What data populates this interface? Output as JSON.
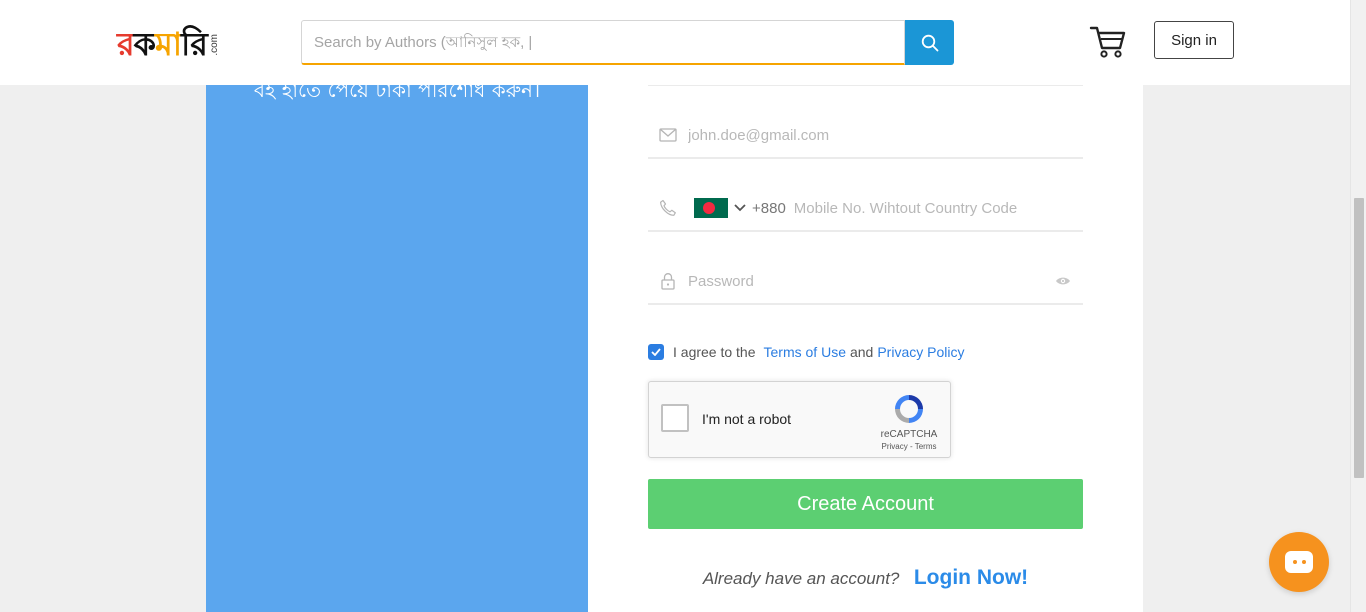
{
  "header": {
    "logo": {
      "main": "রকমারি",
      "suffix": ".com"
    },
    "search": {
      "placeholder": "Search by Authors (আনিসুল হক, |"
    },
    "cart_icon": "cart-icon",
    "signin_label": "Sign in"
  },
  "promo": {
    "text": "বই হাতে পেয়ে টাকা পরিশোধ করুন।"
  },
  "form": {
    "email": {
      "placeholder": "john.doe@gmail.com",
      "icon": "envelope-icon"
    },
    "phone": {
      "country_code": "+880",
      "placeholder": "Mobile No. Wihtout Country Code",
      "icon": "phone-icon",
      "flag": "bangladesh-flag"
    },
    "password": {
      "placeholder": "Password",
      "icon": "lock-icon"
    },
    "agree": {
      "prefix": "I agree to the",
      "terms": "Terms of Use",
      "and": "and",
      "privacy": "Privacy Policy",
      "checked": true
    },
    "recaptcha": {
      "label": "I'm not a robot",
      "brand": "reCAPTCHA",
      "links": "Privacy - Terms"
    },
    "create_button": "Create Account",
    "login": {
      "question": "Already have an account?",
      "link": "Login Now!"
    }
  },
  "colors": {
    "accent_orange": "#f6a400",
    "search_blue": "#1b96d6",
    "panel_blue": "#5ba6ee",
    "create_green": "#5ccf72",
    "link_blue": "#2b7de1",
    "chat_orange": "#f6921e"
  }
}
